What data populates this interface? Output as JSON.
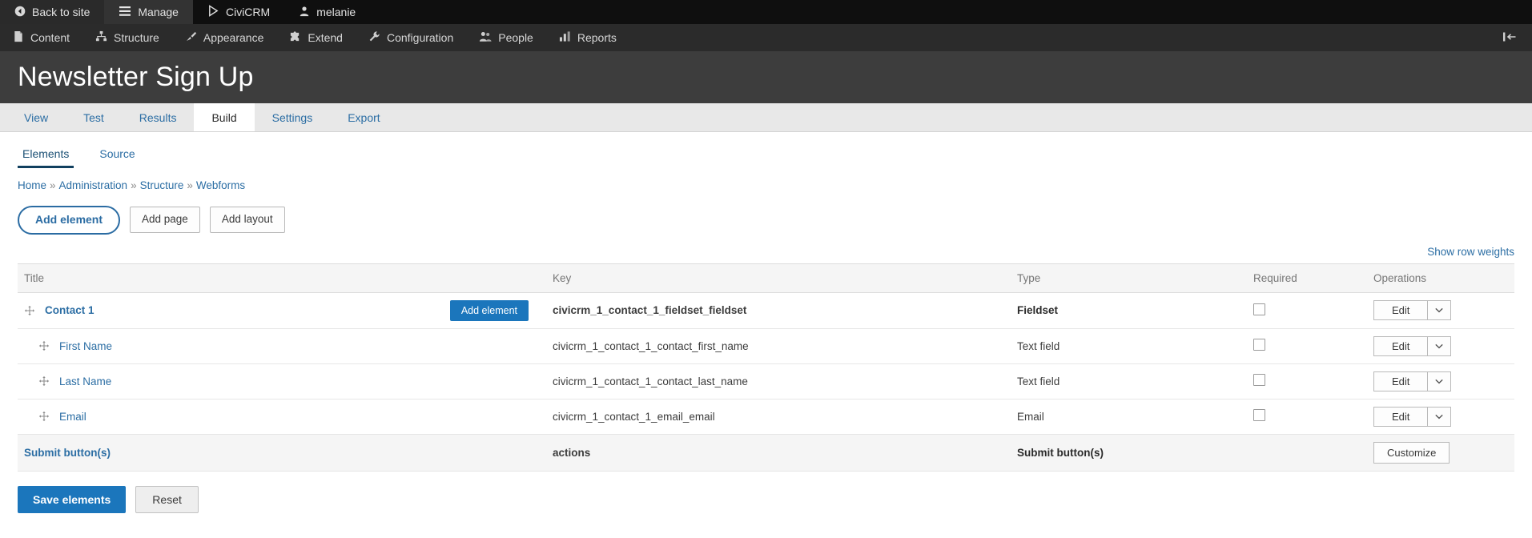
{
  "toolbar": {
    "top_items": [
      {
        "label": "Back to site",
        "icon": "back-arrow-icon",
        "active": false
      },
      {
        "label": "Manage",
        "icon": "hamburger-icon",
        "active": true
      },
      {
        "label": "CiviCRM",
        "icon": "civicrm-triangle-icon",
        "active": false
      },
      {
        "label": "melanie",
        "icon": "user-icon",
        "active": false
      }
    ],
    "menu_items": [
      {
        "label": "Content",
        "icon": "file-icon"
      },
      {
        "label": "Structure",
        "icon": "structure-icon"
      },
      {
        "label": "Appearance",
        "icon": "paintbrush-icon"
      },
      {
        "label": "Extend",
        "icon": "puzzle-icon"
      },
      {
        "label": "Configuration",
        "icon": "wrench-icon"
      },
      {
        "label": "People",
        "icon": "people-icon"
      },
      {
        "label": "Reports",
        "icon": "bar-chart-icon"
      }
    ],
    "collapse_icon": "collapse-sidebar-icon"
  },
  "header": {
    "title": "Newsletter Sign Up"
  },
  "primary_tabs": [
    {
      "label": "View",
      "active": false
    },
    {
      "label": "Test",
      "active": false
    },
    {
      "label": "Results",
      "active": false
    },
    {
      "label": "Build",
      "active": true
    },
    {
      "label": "Settings",
      "active": false
    },
    {
      "label": "Export",
      "active": false
    }
  ],
  "secondary_tabs": [
    {
      "label": "Elements",
      "active": true
    },
    {
      "label": "Source",
      "active": false
    }
  ],
  "breadcrumb": {
    "separator": "»",
    "items": [
      "Home",
      "Administration",
      "Structure",
      "Webforms"
    ]
  },
  "action_buttons": {
    "add_element": "Add element",
    "add_page": "Add page",
    "add_layout": "Add layout",
    "show_row_weights": "Show row weights"
  },
  "table": {
    "columns": [
      "Title",
      "Key",
      "Type",
      "Required",
      "Operations"
    ],
    "rows": [
      {
        "title": "Contact 1",
        "key": "civicrm_1_contact_1_fieldset_fieldset",
        "type": "Fieldset",
        "type_bold": true,
        "required_checked": false,
        "indent": 0,
        "bold_title": true,
        "inline_button": "Add element",
        "op_label": "Edit",
        "op_caret_icon": "chevron-down-icon"
      },
      {
        "title": "First Name",
        "key": "civicrm_1_contact_1_contact_first_name",
        "type": "Text field",
        "type_bold": false,
        "required_checked": false,
        "indent": 1,
        "bold_title": false,
        "inline_button": null,
        "op_label": "Edit",
        "op_caret_icon": "chevron-down-icon"
      },
      {
        "title": "Last Name",
        "key": "civicrm_1_contact_1_contact_last_name",
        "type": "Text field",
        "type_bold": false,
        "required_checked": false,
        "indent": 1,
        "bold_title": false,
        "inline_button": null,
        "op_label": "Edit",
        "op_caret_icon": "chevron-down-icon"
      },
      {
        "title": "Email",
        "key": "civicrm_1_contact_1_email_email",
        "type": "Email",
        "type_bold": false,
        "required_checked": false,
        "indent": 1,
        "bold_title": false,
        "inline_button": null,
        "op_label": "Edit",
        "op_caret_icon": "chevron-down-icon"
      }
    ],
    "submit_row": {
      "title": "Submit button(s)",
      "key": "actions",
      "type": "Submit button(s)",
      "op_label": "Customize"
    }
  },
  "footer": {
    "save_label": "Save elements",
    "reset_label": "Reset"
  },
  "colors": {
    "primary_blue": "#1b76bc",
    "link_blue": "#2c6ea4",
    "toolbar_dark": "#0f0f0f",
    "toolbar_secondary": "#2b2b2b",
    "page_header_bg": "#3d3d3d"
  }
}
